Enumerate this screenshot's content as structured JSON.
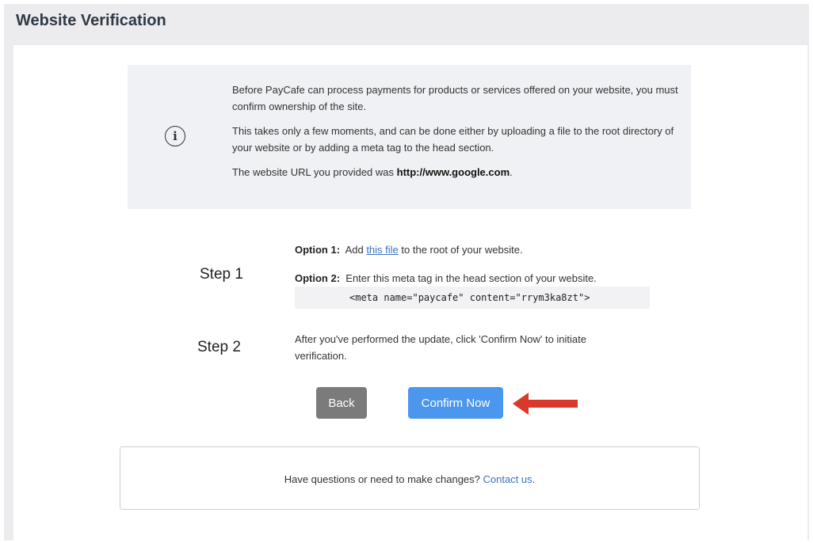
{
  "page": {
    "title": "Website Verification"
  },
  "info": {
    "icon": "info-circle-icon",
    "paragraph1": "Before PayCafe can process payments for products or services offered on your website, you must confirm ownership of the site.",
    "paragraph2": "This takes only a few moments, and can be done either by uploading a file to the root directory of your website or by adding a meta tag to the head section.",
    "url_prefix": "The website URL you provided was ",
    "url": "http://www.google.com",
    "url_suffix": "."
  },
  "step1": {
    "label": "Step 1",
    "option1": {
      "label": "Option 1:",
      "text_before": "Add ",
      "link": "this file",
      "text_after": " to the root of your website."
    },
    "option2": {
      "label": "Option 2:",
      "text": "Enter this meta tag in the head section of your website."
    },
    "meta_tag": "<meta name=\"paycafe\" content=\"rrym3ka8zt\">"
  },
  "step2": {
    "label": "Step 2",
    "text": "After you've performed the update, click 'Confirm Now' to initiate verification."
  },
  "buttons": {
    "back": "Back",
    "confirm": "Confirm Now"
  },
  "annotation": {
    "icon": "red-arrow-icon",
    "color": "#d9392b"
  },
  "contact": {
    "text": "Have questions or need to make changes? ",
    "link": "Contact us",
    "suffix": "."
  },
  "colors": {
    "primary": "#4c97ee",
    "secondary": "#7b7b7b",
    "link": "#3a72c0",
    "info_bg": "#f0f1f4"
  }
}
